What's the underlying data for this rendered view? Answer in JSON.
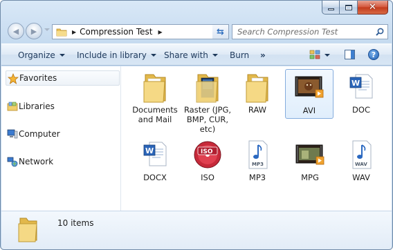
{
  "window": {
    "title_path": "Compression Test",
    "search_placeholder": "Search Compression Test"
  },
  "toolbar": {
    "organize": "Organize",
    "include_in_library": "Include in library",
    "share_with": "Share with",
    "burn": "Burn",
    "more": "»"
  },
  "sidebar": {
    "items": [
      {
        "label": "Favorites",
        "icon": "star-icon"
      },
      {
        "label": "Libraries",
        "icon": "libraries-icon"
      },
      {
        "label": "Computer",
        "icon": "computer-icon"
      },
      {
        "label": "Network",
        "icon": "network-icon"
      }
    ]
  },
  "files": [
    {
      "label": "Documents and Mail",
      "icon": "folder-icon"
    },
    {
      "label": "Raster (JPG, BMP, CUR, etc)",
      "icon": "folder-icon"
    },
    {
      "label": "RAW",
      "icon": "folder-icon"
    },
    {
      "label": "AVI",
      "icon": "video-file-icon"
    },
    {
      "label": "DOC",
      "icon": "word-file-icon"
    },
    {
      "label": "DOCX",
      "icon": "word-file-icon"
    },
    {
      "label": "ISO",
      "icon": "iso-disc-icon",
      "badge": "ISO"
    },
    {
      "label": "MP3",
      "icon": "audio-file-icon",
      "badge": "MP3"
    },
    {
      "label": "MPG",
      "icon": "video-file-icon"
    },
    {
      "label": "WAV",
      "icon": "audio-file-icon",
      "badge": "WAV"
    }
  ],
  "status": {
    "item_count": "10 items"
  },
  "colors": {
    "folder": "#f2d27a",
    "accent": "#3e7fcf",
    "close": "#c23a1c"
  }
}
